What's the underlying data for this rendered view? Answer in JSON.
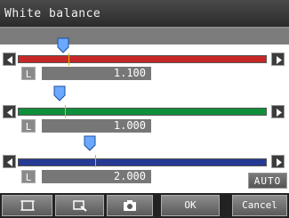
{
  "window": {
    "title": "White balance"
  },
  "channels": [
    {
      "name": "red",
      "color": "#c62828",
      "label": "L",
      "value": "1.100",
      "fraction": 0.198
    },
    {
      "name": "green",
      "color": "#0f8f3b",
      "label": "L",
      "value": "1.000",
      "fraction": 0.18
    },
    {
      "name": "blue",
      "color": "#263a93",
      "label": "L",
      "value": "2.000",
      "fraction": 0.36
    }
  ],
  "buttons": {
    "auto": "AUTO",
    "ok": "OK",
    "cancel": "Cancel"
  },
  "icons": [
    "area-select-icon",
    "zoom-icon",
    "camera-icon",
    "left-arrow-icon",
    "right-arrow-icon",
    "slider-handle-icon"
  ]
}
